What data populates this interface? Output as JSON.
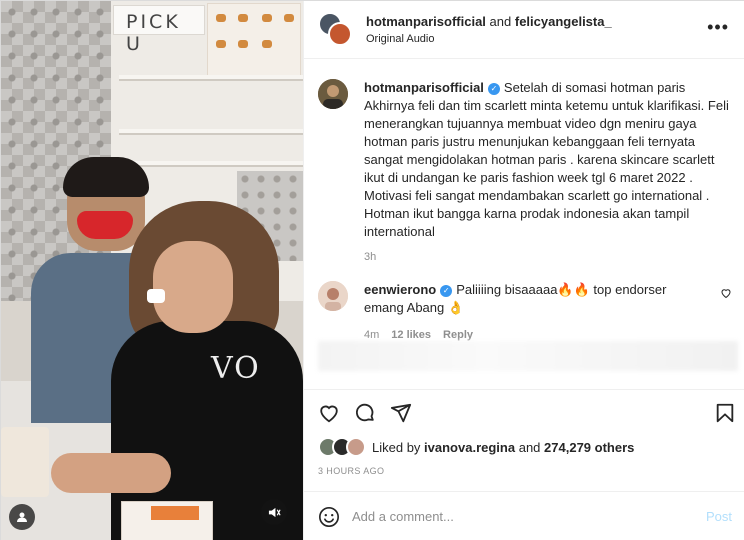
{
  "header": {
    "user1": "hotmanparisofficial",
    "and": "and",
    "user2": "felicyangelista_",
    "audio": "Original Audio",
    "more_icon": "more-horizontal-icon"
  },
  "media": {
    "sign_text": "PICK U",
    "shirt_text": "VO",
    "user_icon": "user-tag-icon",
    "mute_icon": "muted-speaker-icon"
  },
  "caption": {
    "username": "hotmanparisofficial",
    "verified": true,
    "text": "Setelah di somasi hotman paris Akhirnya feli dan tim scarlett minta ketemu untuk klarifikasi. Feli menerangkan tujuannya membuat video dgn meniru gaya hotman paris justru menunjukan kebanggaan feli ternyata sangat mengidolakan hotman paris . karena skincare scarlett ikut di undangan ke paris fashion week tgl 6 maret 2022 . Motivasi feli sangat mendambakan scarlett go international . Hotman ikut bangga karna prodak indonesia akan tampil international",
    "time": "3h"
  },
  "comment": {
    "username": "eenwierono",
    "verified": true,
    "text": "Paliiiing bisaaaaa🔥🔥 top endorser emang Abang 👌",
    "time": "4m",
    "likes": "12 likes",
    "reply": "Reply",
    "heart_icon": "heart-outline-icon"
  },
  "actions": {
    "like_icon": "heart-icon",
    "comment_icon": "comment-icon",
    "share_icon": "share-icon",
    "save_icon": "bookmark-icon"
  },
  "likes": {
    "prefix": "Liked by",
    "user": "ivanova.regina",
    "and": "and",
    "count": "274,279 others"
  },
  "timestamp": "3 HOURS AGO",
  "add_comment": {
    "placeholder": "Add a comment...",
    "post_label": "Post",
    "emoji_icon": "emoji-icon"
  },
  "colors": {
    "verified_blue": "#3897f0",
    "post_disabled": "#b2dffc",
    "meta_gray": "#8e8e8e",
    "text_dark": "#262626"
  }
}
